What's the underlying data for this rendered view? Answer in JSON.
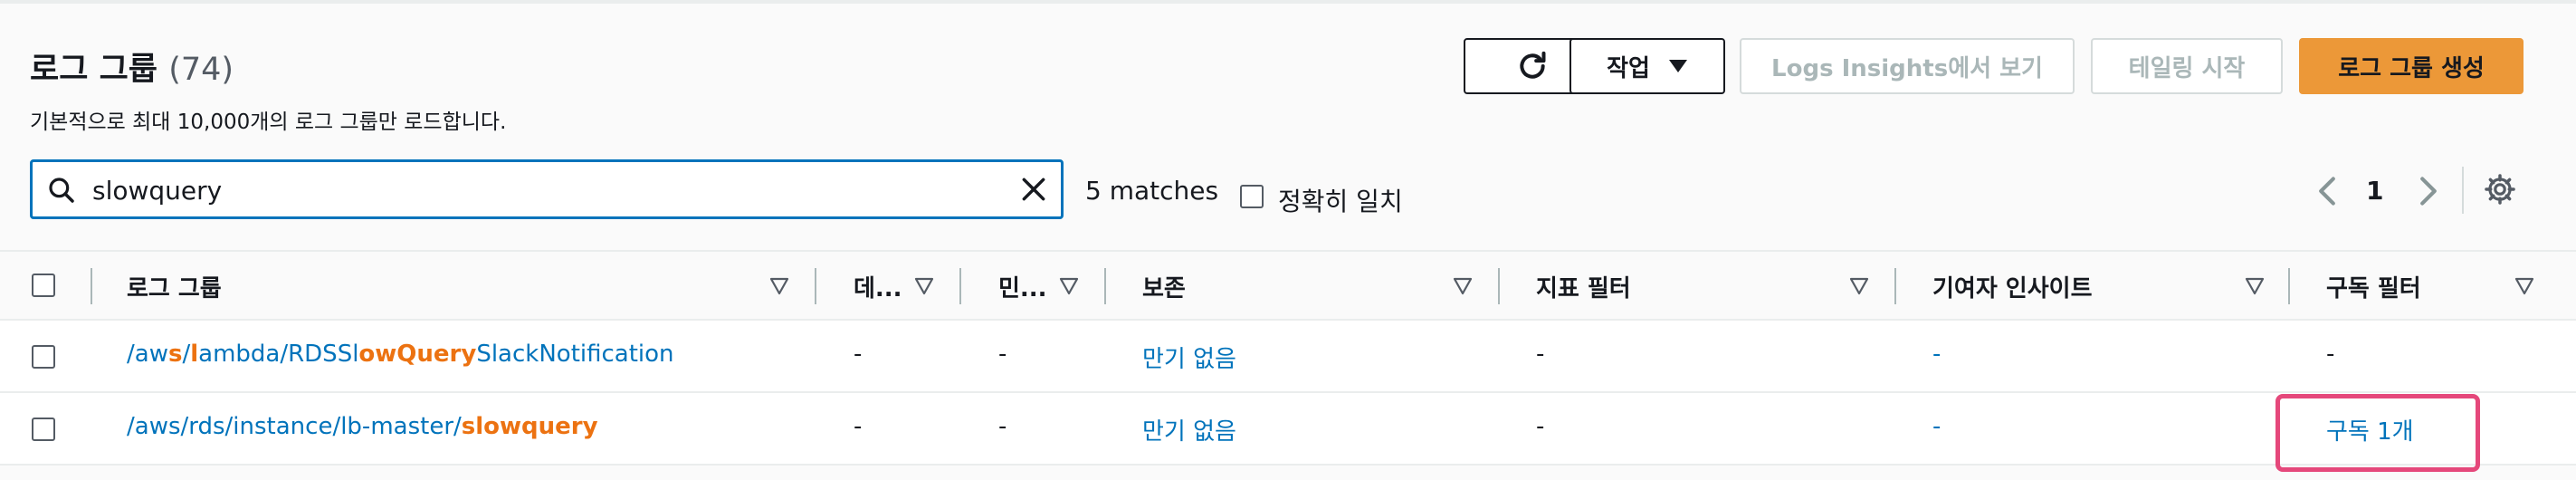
{
  "header": {
    "title": "로그 그룹",
    "count": "(74)",
    "subtitle": "기본적으로 최대 10,000개의 로그 그룹만 로드합니다."
  },
  "toolbar": {
    "actions_label": "작업",
    "insights_label": "Logs Insights에서 보기",
    "tailing_label": "테일링 시작",
    "create_label": "로그 그룹 생성"
  },
  "search": {
    "value": "slowquery",
    "matches": "5 matches",
    "exact_match_label": "정확히 일치"
  },
  "pagination": {
    "current_page": "1"
  },
  "table": {
    "columns": [
      "로그 그룹",
      "데...",
      "민...",
      "보존",
      "지표 필터",
      "기여자 인사이트",
      "구독 필터"
    ],
    "rows": [
      {
        "log_group_parts": [
          {
            "text": "/aw",
            "hl": false
          },
          {
            "text": "s",
            "hl": true
          },
          {
            "text": "/",
            "hl": false
          },
          {
            "text": "l",
            "hl": true
          },
          {
            "text": "ambda/RDSSl",
            "hl": false
          },
          {
            "text": "owQuery",
            "hl": true
          },
          {
            "text": "SlackNotification",
            "hl": false
          }
        ],
        "data_protection": "-",
        "sensitive": "-",
        "retention": "만기 없음",
        "metric_filters": "-",
        "contributor_insights": "-",
        "subscription_filters": "-"
      },
      {
        "log_group_parts": [
          {
            "text": "/aws/rds/instance/lb-master/",
            "hl": false
          },
          {
            "text": "slowquery",
            "hl": true
          }
        ],
        "data_protection": "-",
        "sensitive": "-",
        "retention": "만기 없음",
        "metric_filters": "-",
        "contributor_insights": "-",
        "subscription_filters": "구독 1개"
      }
    ]
  },
  "colors": {
    "primary": "#ec9838",
    "link": "#0073bb",
    "match_highlight": "#ec7211",
    "annotation": "#e5487b"
  },
  "icons": {
    "refresh": "refresh-icon",
    "caret": "caret-down-icon",
    "search": "search-icon",
    "clear": "close-icon",
    "prev": "chevron-left-icon",
    "next": "chevron-right-icon",
    "settings": "gear-icon",
    "sort": "sort-down-icon"
  }
}
